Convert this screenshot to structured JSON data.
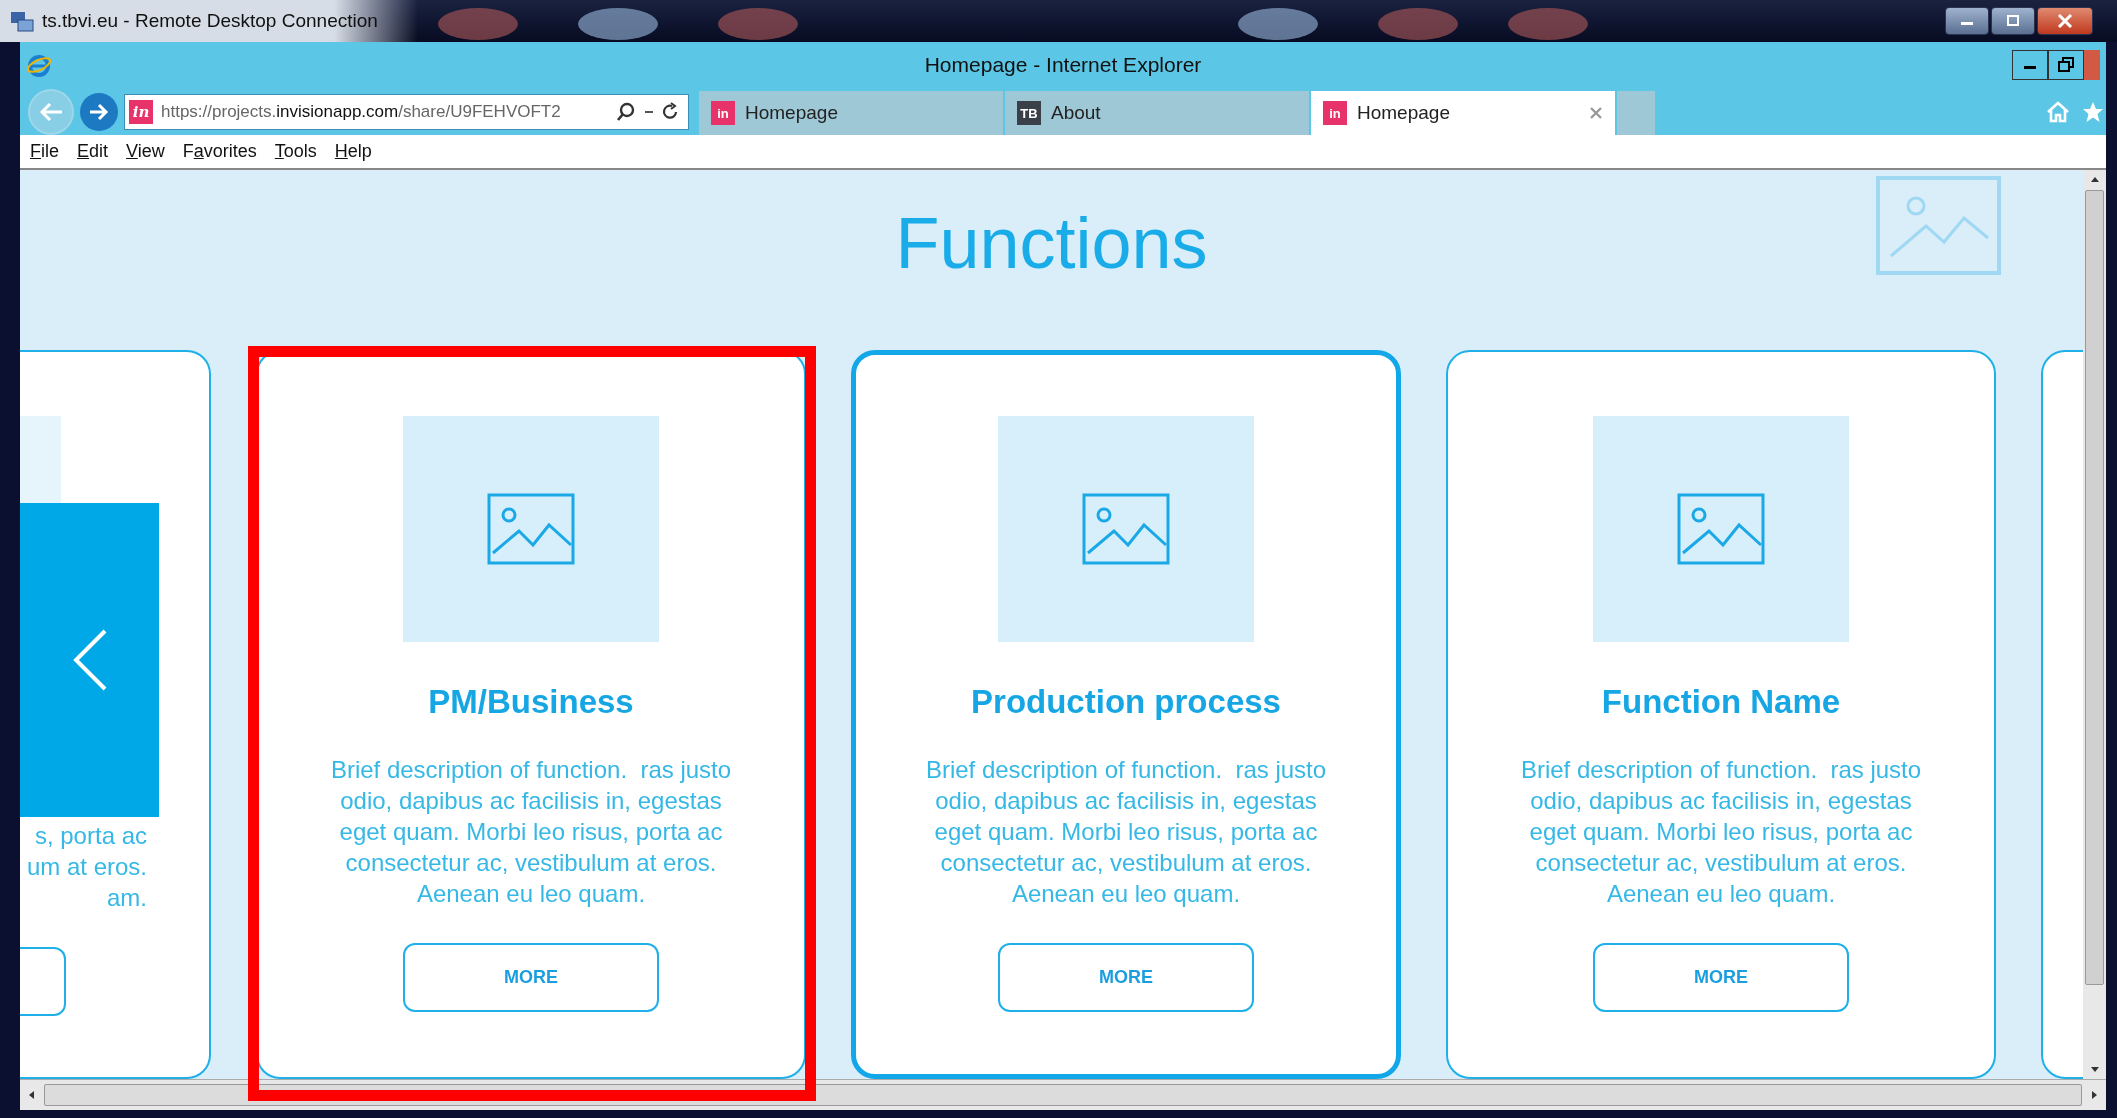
{
  "remote_window": {
    "title": "ts.tbvi.eu - Remote Desktop Connection"
  },
  "browser": {
    "title": "Homepage - Internet Explorer",
    "address": {
      "prefix": "https://projects.",
      "domain": "invisionapp.com",
      "path": "/share/U9FEHVOFT2",
      "icon_text": "in"
    },
    "tabs": [
      {
        "color": "#e8336a",
        "icon_text": "in",
        "label": "Homepage",
        "selected": false
      },
      {
        "color": "#3a4048",
        "icon_text": "TB",
        "label": "About",
        "selected": false
      },
      {
        "color": "#e8336a",
        "icon_text": "in",
        "label": "Homepage",
        "selected": true
      }
    ],
    "menu": [
      {
        "key": "F",
        "rest": "ile"
      },
      {
        "key": "E",
        "rest": "dit"
      },
      {
        "key": "V",
        "rest": "iew"
      },
      {
        "lead": "F",
        "key": "a",
        "rest": "vorites"
      },
      {
        "key": "T",
        "rest": "ools"
      },
      {
        "key": "H",
        "rest": "elp"
      }
    ]
  },
  "page": {
    "heading": "Functions",
    "cards": [
      {
        "kind": "cut_left",
        "description_lines": [
          "s, porta ac",
          "um at eros.",
          "am."
        ]
      },
      {
        "kind": "full",
        "title": "PM/Business",
        "description_lines": [
          "Brief description of function.  ras justo",
          "odio, dapibus ac facilisis in, egestas",
          "eget quam. Morbi leo risus, porta ac",
          "consectetur ac, vestibulum at eros.",
          "Aenean eu leo quam."
        ],
        "button": "MORE",
        "focused": false,
        "annotated": true
      },
      {
        "kind": "full",
        "title": "Production process",
        "description_lines": [
          "Brief description of function.  ras justo",
          "odio, dapibus ac facilisis in, egestas",
          "eget quam. Morbi leo risus, porta ac",
          "consectetur ac, vestibulum at eros.",
          "Aenean eu leo quam."
        ],
        "button": "MORE",
        "focused": true,
        "annotated": false
      },
      {
        "kind": "full",
        "title": "Function Name",
        "description_lines": [
          "Brief description of function.  ras justo",
          "odio, dapibus ac facilisis in, egestas",
          "eget quam. Morbi leo risus, porta ac",
          "consectetur ac, vestibulum at eros.",
          "Aenean eu leo quam."
        ],
        "button": "MORE",
        "focused": false,
        "annotated": false
      },
      {
        "kind": "cut_right"
      }
    ]
  }
}
